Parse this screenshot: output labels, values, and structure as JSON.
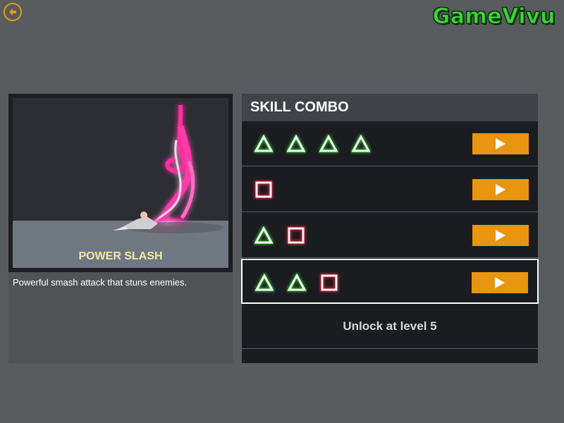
{
  "header": {
    "back_icon": "back-arrow-icon",
    "logo_text": "GameVivu",
    "logo_color": "#3dd43a"
  },
  "skill": {
    "name": "POWER SLASH",
    "description": "Powerful smash attack that stuns enemies."
  },
  "combo": {
    "title": "SKILL COMBO",
    "rows": [
      {
        "symbols": [
          "triangle",
          "triangle",
          "triangle",
          "triangle"
        ],
        "selected": false,
        "play_icon": "play-icon"
      },
      {
        "symbols": [
          "square"
        ],
        "selected": false,
        "play_icon": "play-icon"
      },
      {
        "symbols": [
          "triangle",
          "square"
        ],
        "selected": false,
        "play_icon": "play-icon"
      },
      {
        "symbols": [
          "triangle",
          "triangle",
          "square"
        ],
        "selected": true,
        "play_icon": "play-icon"
      }
    ],
    "locked_text": "Unlock at level 5"
  },
  "colors": {
    "triangle": "#3ee840",
    "square": "#e8243a",
    "play_button": "#e8950f",
    "accent": "#e39a1a"
  }
}
